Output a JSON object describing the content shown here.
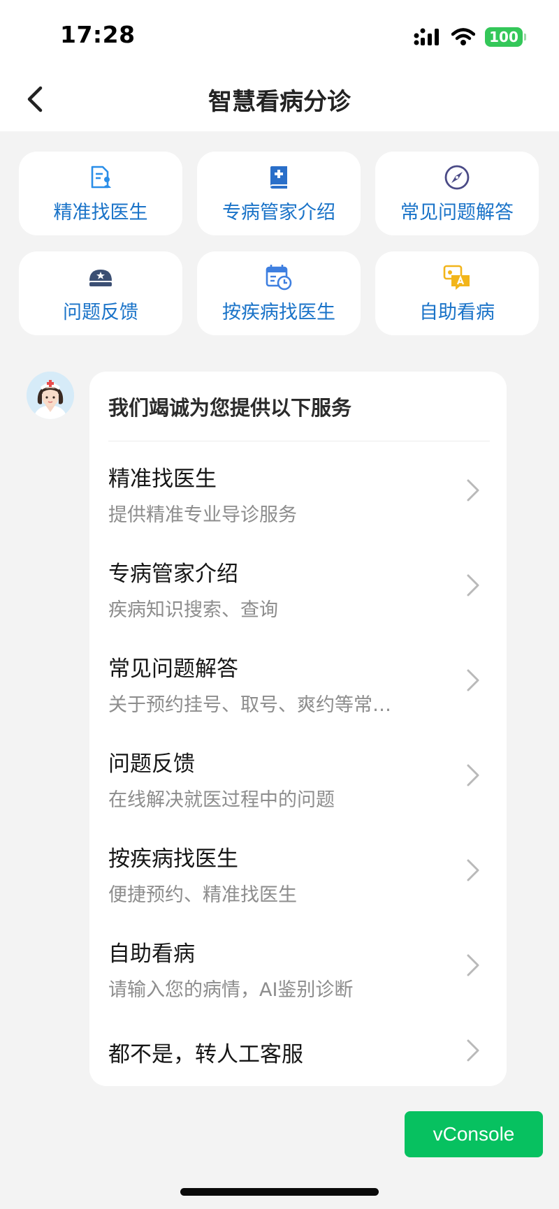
{
  "status_bar": {
    "time": "17:28",
    "battery": "100"
  },
  "nav": {
    "title": "智慧看病分诊"
  },
  "tiles": [
    {
      "label": "精准找医生",
      "icon": "doctor-profile-icon",
      "color": "#2a8ee8"
    },
    {
      "label": "专病管家介绍",
      "icon": "medical-book-icon",
      "color": "#2a6fc9"
    },
    {
      "label": "常见问题解答",
      "icon": "compass-icon",
      "color": "#4a4a86"
    },
    {
      "label": "问题反馈",
      "icon": "nurse-cap-icon",
      "color": "#3b4f73"
    },
    {
      "label": "按疾病找医生",
      "icon": "calendar-clock-icon",
      "color": "#3e7fe0"
    },
    {
      "label": "自助看病",
      "icon": "chat-translate-icon",
      "color": "#f2b51b"
    }
  ],
  "card": {
    "header": "我们竭诚为您提供以下服务",
    "items": [
      {
        "title": "精准找医生",
        "desc": "提供精准专业导诊服务"
      },
      {
        "title": "专病管家介绍",
        "desc": "疾病知识搜索、查询"
      },
      {
        "title": "常见问题解答",
        "desc": "关于预约挂号、取号、爽约等常…"
      },
      {
        "title": "问题反馈",
        "desc": "在线解决就医过程中的问题"
      },
      {
        "title": "按疾病找医生",
        "desc": "便捷预约、精准找医生"
      },
      {
        "title": "自助看病",
        "desc": "请输入您的病情，AI鉴别诊断"
      },
      {
        "title": "都不是，转人工客服"
      }
    ]
  },
  "vconsole": {
    "label": "vConsole"
  }
}
